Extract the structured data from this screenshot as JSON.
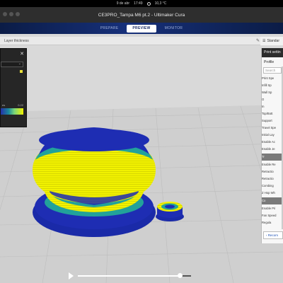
{
  "os_bar": {
    "date": "9 de abr",
    "time": "17:49",
    "weather": "10,3 °C"
  },
  "window": {
    "title": "CE3PRO_Tampa M6 pt.2 - Ultimaker Cura"
  },
  "stages": [
    {
      "label": "PREPARE",
      "active": false
    },
    {
      "label": "PREVIEW",
      "active": true
    },
    {
      "label": "MONITOR",
      "active": false
    }
  ],
  "toolbar": {
    "left_text": "Layer thickness",
    "right_text": "Standar"
  },
  "layer_panel": {
    "gradient_left": "es",
    "gradient_right": "0.22"
  },
  "print_settings": {
    "header": "Print settin",
    "profile_label": "Profile",
    "search_placeholder": "Search",
    "items": [
      {
        "label": "Print Spe",
        "category": false
      },
      {
        "label": "Infill Sp",
        "category": false
      },
      {
        "label": "Wall Sp",
        "category": false
      },
      {
        "label": "O",
        "category": false
      },
      {
        "label": "In",
        "category": false
      },
      {
        "label": "Top/Bott",
        "category": false
      },
      {
        "label": "Support",
        "category": false
      },
      {
        "label": "Travel Spe",
        "category": false
      },
      {
        "label": "Initial Lay",
        "category": false
      },
      {
        "label": "Enable Ac",
        "category": false
      },
      {
        "label": "Enable Je",
        "category": false
      },
      {
        "label": "Tr",
        "category": true
      },
      {
        "label": "Enable Re",
        "category": false
      },
      {
        "label": "Retractio",
        "category": false
      },
      {
        "label": "Retractio",
        "category": false
      },
      {
        "label": "Combing",
        "category": false
      },
      {
        "label": "Z Hop Wh",
        "category": false
      },
      {
        "label": "Co",
        "category": true
      },
      {
        "label": "Enable Pri",
        "category": false
      },
      {
        "label": "Fan Speed",
        "category": false
      },
      {
        "label": "Regula",
        "category": false
      }
    ],
    "recommended_button": "Recom"
  },
  "video": {
    "progress": 0.9
  },
  "colors": {
    "model_blue": "#1e2db3",
    "model_yellow": "#f2f200",
    "model_teal": "#21a39a",
    "stage_bar": "#16307a",
    "accent_link": "#1a4fb5"
  }
}
